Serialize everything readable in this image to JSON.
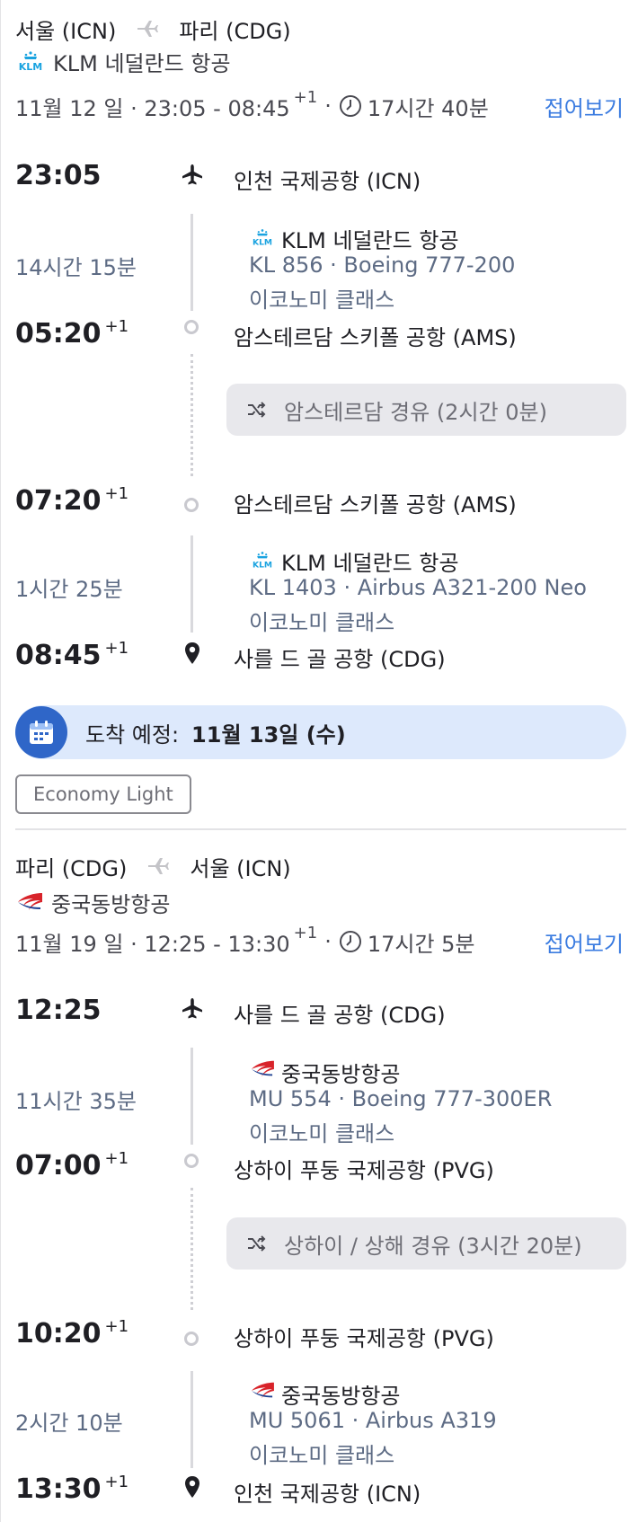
{
  "outbound": {
    "origin": "서울 (ICN)",
    "destination": "파리 (CDG)",
    "airline": "KLM 네덜란드 항공",
    "date_time": "11월 12 일 · 23:05 - 08:45",
    "plus_day": "+1",
    "total_duration": "17시간 40분",
    "collapse_label": "접어보기",
    "dep_time": "23:05",
    "dep_airport": "인천 국제공항 (ICN)",
    "seg1": {
      "duration": "14시간 15분",
      "airline": "KLM 네덜란드 항공",
      "flight": "KL 856 · Boeing 777-200",
      "cabin": "이코노미 클래스"
    },
    "arr1_time": "05:20",
    "arr1_airport": "암스테르담 스키폴 공항 (AMS)",
    "layover": "암스테르담 경유 (2시간 0분)",
    "dep2_time": "07:20",
    "dep2_airport": "암스테르담 스키폴 공항 (AMS)",
    "seg2": {
      "duration": "1시간 25분",
      "airline": "KLM 네덜란드 항공",
      "flight": "KL 1403 · Airbus A321-200 Neo",
      "cabin": "이코노미 클래스"
    },
    "arr2_time": "08:45",
    "arr2_airport": "사를 드 골 공항 (CDG)"
  },
  "arrival_notice": {
    "label": "도착 예정:",
    "date": "11월 13일 (수)"
  },
  "fare_badge": "Economy Light",
  "inbound": {
    "origin": "파리 (CDG)",
    "destination": "서울 (ICN)",
    "airline": "중국동방항공",
    "date_time": "11월 19 일 · 12:25 - 13:30",
    "plus_day": "+1",
    "total_duration": "17시간 5분",
    "collapse_label": "접어보기",
    "dep_time": "12:25",
    "dep_airport": "사를 드 골 공항 (CDG)",
    "seg1": {
      "duration": "11시간 35분",
      "airline": "중국동방항공",
      "flight": "MU 554 · Boeing 777-300ER",
      "cabin": "이코노미 클래스"
    },
    "arr1_time": "07:00",
    "arr1_airport": "상하이 푸둥 국제공항 (PVG)",
    "layover": "상하이 / 상해 경유 (3시간 20분)",
    "dep2_time": "10:20",
    "dep2_airport": "상하이 푸둥 국제공항 (PVG)",
    "seg2": {
      "duration": "2시간 10분",
      "airline": "중국동방항공",
      "flight": "MU 5061 · Airbus A319",
      "cabin": "이코노미 클래스"
    },
    "arr2_time": "13:30",
    "arr2_airport": "인천 국제공항 (ICN)"
  },
  "brand_logos": {
    "klm": "KLM"
  },
  "colors": {
    "link": "#3a7be0",
    "klm": "#1aa3e0",
    "china_eastern_red": "#d8232a",
    "china_eastern_blue": "#1d3f91",
    "arrival_bg": "#dde9fc",
    "calendar": "#2f66c8"
  }
}
